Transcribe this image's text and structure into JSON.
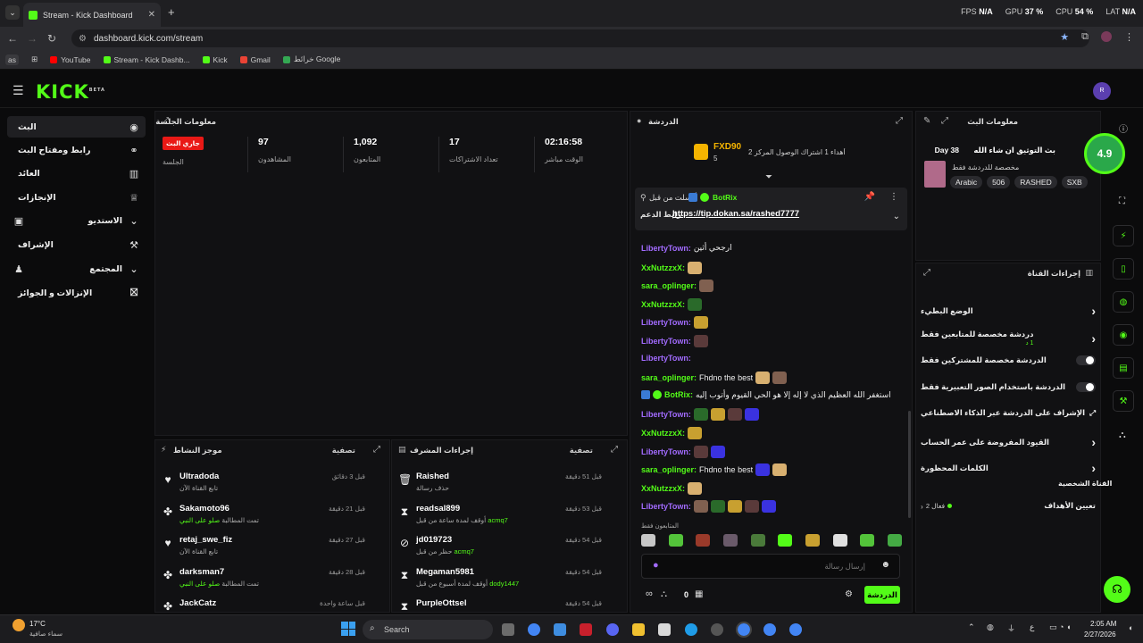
{
  "browser": {
    "tab_title": "Stream - Kick Dashboard",
    "url": "dashboard.kick.com/stream",
    "perf": {
      "fps_label": "FPS",
      "fps": "N/A",
      "gpu_label": "GPU",
      "gpu": "37 %",
      "cpu_label": "CPU",
      "cpu": "54 %",
      "lat_label": "LAT",
      "lat": "N/A"
    },
    "bookmarks": [
      "YouTube",
      "Stream - Kick Dashb...",
      "Kick",
      "Gmail",
      "خرائط Google"
    ],
    "profile_chip": "as"
  },
  "header": {
    "logo": "KICK",
    "logo_badge": "BETA",
    "user_initial": "R"
  },
  "sidebar": {
    "items": [
      {
        "label": "البث",
        "icon": "live-icon"
      },
      {
        "label": "رابط ومفتاح البث",
        "icon": "link-icon"
      },
      {
        "label": "العائد",
        "icon": "chart-icon"
      },
      {
        "label": "الإنجازات",
        "icon": "trophy-icon"
      },
      {
        "label": "الاستديو",
        "icon": "chevron-down-icon"
      },
      {
        "label": "الإشراف",
        "icon": "hammer-icon"
      },
      {
        "label": "المجتمع",
        "icon": "chevron-down-icon"
      },
      {
        "label": "الإنزالات و الجوائز",
        "icon": "gift-icon"
      }
    ]
  },
  "session": {
    "title": "معلومات الجلسة",
    "live_badge": "جاري البث",
    "live_label": "الجلسة",
    "stats": [
      {
        "value": "97",
        "label": "المشاهدون"
      },
      {
        "value": "1,092",
        "label": "المتابعون"
      },
      {
        "value": "17",
        "label": "تعداد الاشتراكات"
      },
      {
        "value": "02:16:58",
        "label": "الوقت مباشر"
      }
    ]
  },
  "activity": {
    "title": "موجز النشاط",
    "filter": "تصفية",
    "rows": [
      {
        "name": "Ultradoda",
        "sub": "تابع القناة الآن",
        "time": "قبل 3 دقائق",
        "icon": "heart-icon"
      },
      {
        "name": "Sakamoto96",
        "sub": "تمت المطالبة",
        "sub_em": "صلو على النبي",
        "time": "قبل 21 دقيقة",
        "icon": "gift-icon"
      },
      {
        "name": "retaj_swe_fiz",
        "sub": "تابع القناة الآن",
        "time": "قبل 27 دقيقة",
        "icon": "heart-icon"
      },
      {
        "name": "darksman7",
        "sub": "تمت المطالبة",
        "sub_em": "صلو على النبي",
        "time": "قبل 28 دقيقة",
        "icon": "gift-icon"
      },
      {
        "name": "JackCatz",
        "sub": "",
        "time": "قبل ساعة واحدة",
        "icon": "gift-icon"
      }
    ]
  },
  "modactions": {
    "title": "إجراءات المشرف",
    "filter": "تصفية",
    "rows": [
      {
        "name": "Raished",
        "sub": "حذف رسالة",
        "time": "قبل 51 دقيقة",
        "icon": "trash-icon"
      },
      {
        "name": "readsal899",
        "sub": "أوقف لمدة ساعة من قبل",
        "sub_em": "acmq7",
        "time": "قبل 53 دقيقة",
        "icon": "hourglass-icon"
      },
      {
        "name": "jd019723",
        "sub": "حظر من قبل",
        "sub_em": "acmq7",
        "time": "قبل 54 دقيقة",
        "icon": "ban-icon"
      },
      {
        "name": "Megaman5981",
        "sub": "أوقف لمدة أسبوع من قبل",
        "sub_em": "dody1447",
        "time": "قبل 54 دقيقة",
        "icon": "hourglass-icon"
      },
      {
        "name": "PurpleOttsel",
        "sub": "",
        "time": "قبل 54 دقيقة",
        "icon": "hourglass-icon"
      }
    ]
  },
  "chat": {
    "title": "الدردشة",
    "leader": {
      "name": "FXD90",
      "count": "5"
    },
    "gifts_note": "أهداء 1 اشتراك الوصول المركز 2",
    "pinned": {
      "by_label": "أرسلت من قبل",
      "user": "BotRix",
      "label": "رابط الدعم",
      "link": "https://tip.dokan.sa/rashed7777"
    },
    "messages": [
      {
        "user": "LibertyTown",
        "color": "#a26bff",
        "text": "ارجحي أثين",
        "emotes": 0
      },
      {
        "user": "XxNutzzxX",
        "color": "#53fc18",
        "text": "",
        "emotes": 1
      },
      {
        "user": "sara_oplinger",
        "color": "#53fc18",
        "text": "",
        "emotes": 1
      },
      {
        "user": "XxNutzzxX",
        "color": "#53fc18",
        "text": "",
        "emotes": 1
      },
      {
        "user": "LibertyTown",
        "color": "#a26bff",
        "text": "",
        "emotes": 1
      },
      {
        "user": "LibertyTown",
        "color": "#a26bff",
        "text": "",
        "emotes": 1
      },
      {
        "user": "LibertyTown",
        "color": "#a26bff",
        "text": "",
        "emotes": 0
      },
      {
        "user": "sara_oplinger",
        "color": "#53fc18",
        "text": "Fhdno the best",
        "emotes": 2
      },
      {
        "user": "BotRix",
        "color": "#53fc18",
        "text": "استغفر الله العظيم الذي لا إله إلا هو الحي القيوم وأتوب إليه",
        "emotes": 0
      },
      {
        "user": "LibertyTown",
        "color": "#a26bff",
        "text": "",
        "emotes": 4
      },
      {
        "user": "XxNutzzxX",
        "color": "#53fc18",
        "text": "",
        "emotes": 1
      },
      {
        "user": "LibertyTown",
        "color": "#a26bff",
        "text": "",
        "emotes": 2
      },
      {
        "user": "sara_oplinger",
        "color": "#53fc18",
        "text": "Fhdno the best",
        "emotes": 2
      },
      {
        "user": "XxNutzzxX",
        "color": "#53fc18",
        "text": "",
        "emotes": 1
      },
      {
        "user": "LibertyTown",
        "color": "#a26bff",
        "text": "",
        "emotes": 5
      }
    ],
    "followers_only": "المتابعون فقط",
    "input_placeholder": "إرسال رسالة",
    "send": "الدردشة",
    "points": "0"
  },
  "streaminfo": {
    "title": "معلومات البث",
    "stream_title": "بث التوثيق ان شاء الله",
    "day": "Day 38",
    "category": "مخصصة للدردشة فقط",
    "tags": [
      "Arabic",
      "506",
      "RASHED",
      "SXB"
    ],
    "rating": "4.9"
  },
  "channel": {
    "title": "إجراءات القناة",
    "rows": [
      {
        "label": "الوضع البطيء",
        "type": "chevron"
      },
      {
        "label": "دردشة مخصصة للمتابعين فقط",
        "sub": "1 د",
        "type": "chevron"
      },
      {
        "label": "الدردشة مخصصة للمشتركين فقط",
        "type": "toggle"
      },
      {
        "label": "الدردشة باستخدام الصور التعبيرية فقط",
        "type": "toggle"
      },
      {
        "label": "الإشراف على الدردشة عبر الذكاء الاصطناعي",
        "type": "external"
      },
      {
        "label": "القيود المفروضة على عمر الحساب",
        "type": "chevron"
      },
      {
        "label": "الكلمات المحظورة",
        "type": "chevron"
      }
    ],
    "sub_heading": "القناة الشخصية",
    "goal_label": "تعيين الأهداف",
    "goal_value": "فعال 2"
  },
  "taskbar": {
    "temp": "17°C",
    "weather": "سماء صافية",
    "search": "Search",
    "time": "2:05 AM",
    "date": "2/27/2026"
  }
}
